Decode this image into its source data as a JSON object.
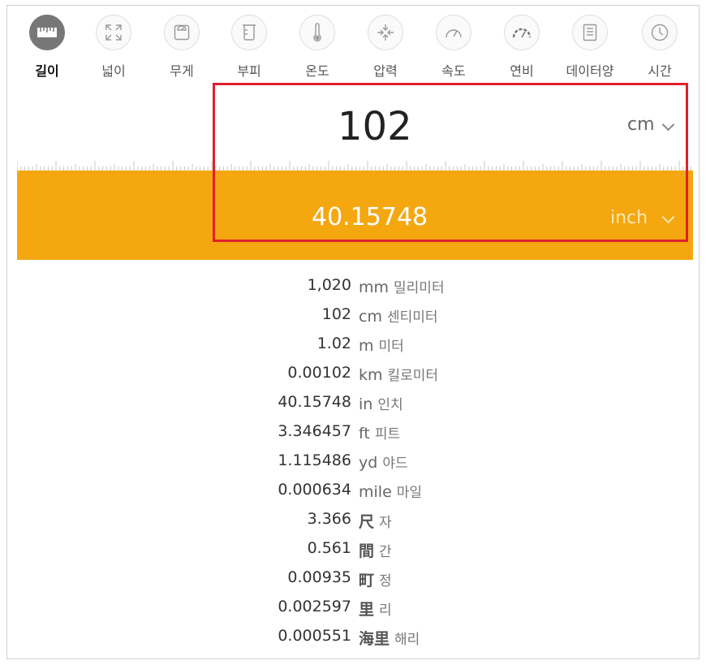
{
  "categories": [
    {
      "label": "길이",
      "icon": "ruler-icon",
      "active": true
    },
    {
      "label": "넓이",
      "icon": "expand-arrows-icon"
    },
    {
      "label": "무게",
      "icon": "scale-icon"
    },
    {
      "label": "부피",
      "icon": "beaker-icon"
    },
    {
      "label": "온도",
      "icon": "thermometer-icon"
    },
    {
      "label": "압력",
      "icon": "compress-arrows-icon"
    },
    {
      "label": "속도",
      "icon": "speedometer-icon"
    },
    {
      "label": "연비",
      "icon": "fuel-gauge-icon"
    },
    {
      "label": "데이터양",
      "icon": "document-icon"
    },
    {
      "label": "시간",
      "icon": "clock-icon"
    }
  ],
  "from": {
    "value": "102",
    "unit": "cm"
  },
  "to": {
    "value": "40.15748",
    "unit": "inch"
  },
  "colors": {
    "accent": "#f4a70f",
    "highlight": "#e0202a",
    "active_icon": "#777777"
  },
  "results": [
    {
      "value": "1,020",
      "unit": "mm",
      "name": "밀리미터"
    },
    {
      "value": "102",
      "unit": "cm",
      "name": "센티미터"
    },
    {
      "value": "1.02",
      "unit": "m",
      "name": "미터"
    },
    {
      "value": "0.00102",
      "unit": "km",
      "name": "킬로미터"
    },
    {
      "value": "40.15748",
      "unit": "in",
      "name": "인치"
    },
    {
      "value": "3.346457",
      "unit": "ft",
      "name": "피트"
    },
    {
      "value": "1.115486",
      "unit": "yd",
      "name": "야드"
    },
    {
      "value": "0.000634",
      "unit": "mile",
      "name": "마일"
    },
    {
      "value": "3.366",
      "unit": "尺",
      "name": "자"
    },
    {
      "value": "0.561",
      "unit": "間",
      "name": "간"
    },
    {
      "value": "0.00935",
      "unit": "町",
      "name": "정"
    },
    {
      "value": "0.002597",
      "unit": "里",
      "name": "리"
    },
    {
      "value": "0.000551",
      "unit": "海里",
      "name": "해리"
    }
  ]
}
